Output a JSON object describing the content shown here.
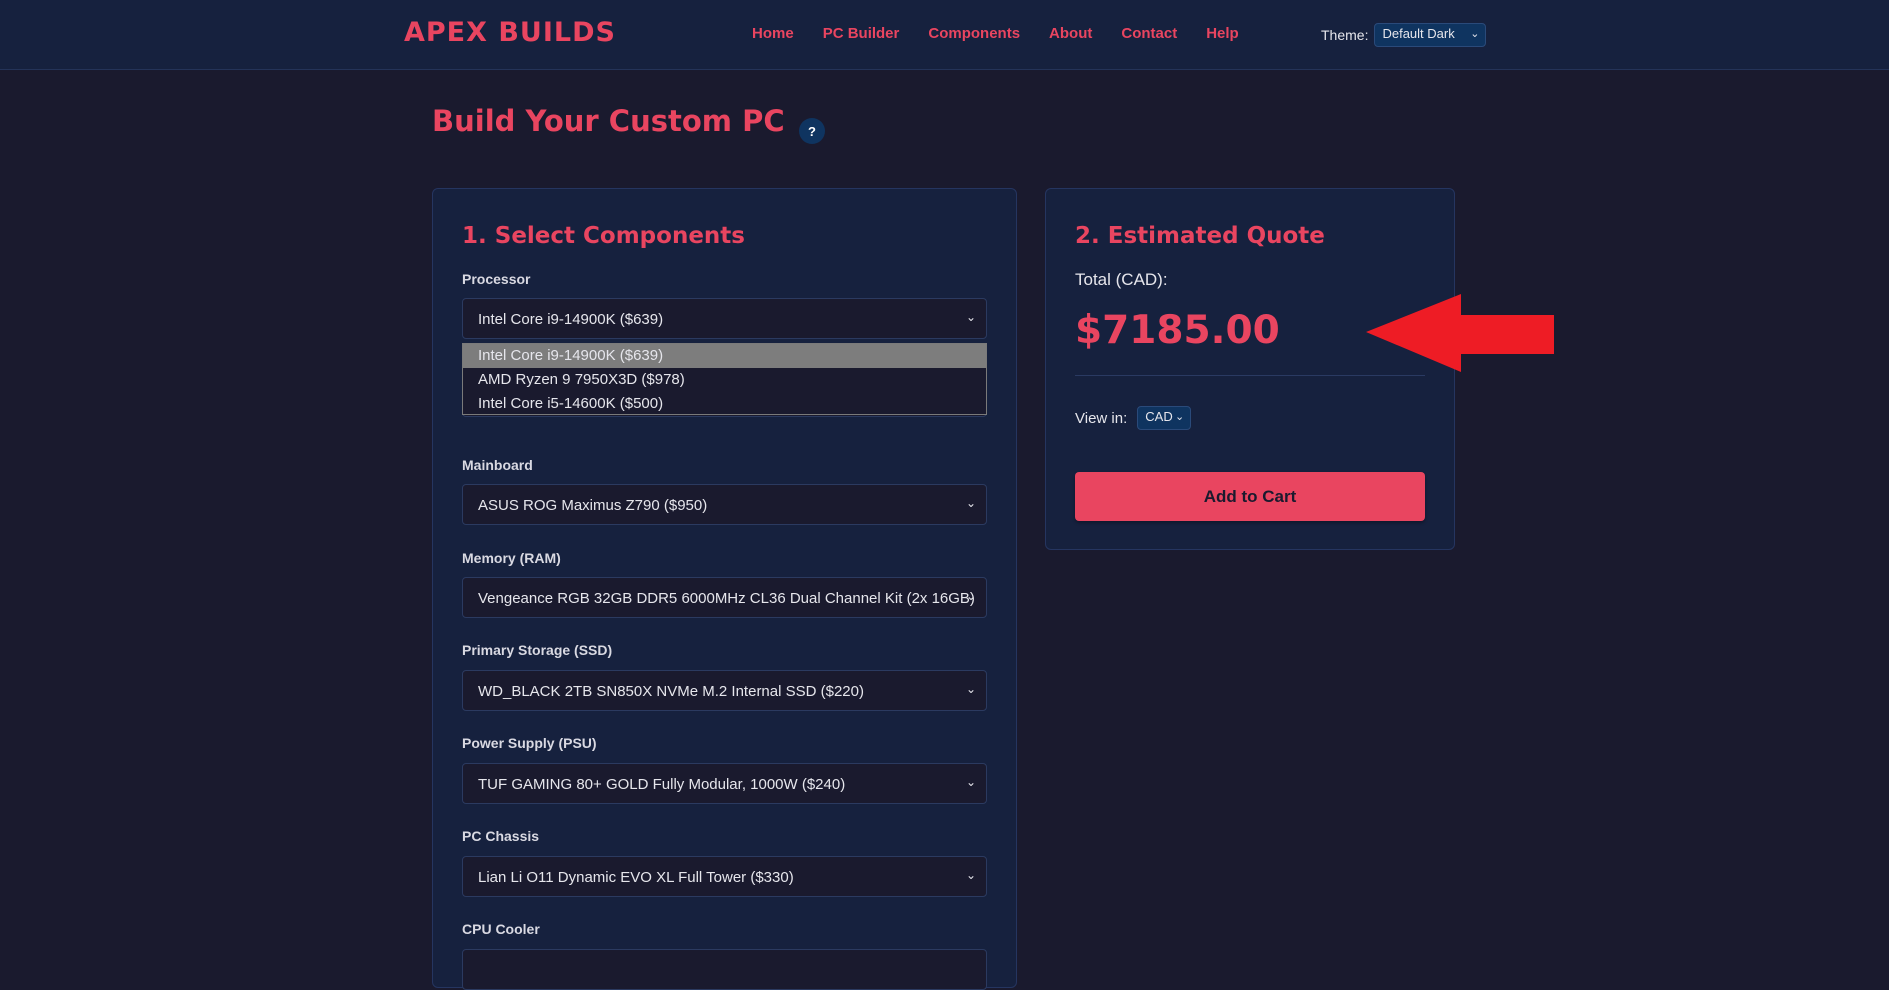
{
  "header": {
    "logo": "APEX BUILDS",
    "nav": [
      "Home",
      "PC Builder",
      "Components",
      "About",
      "Contact",
      "Help"
    ],
    "theme_label": "Theme:",
    "theme_value": "Default Dark"
  },
  "page": {
    "title": "Build Your Custom PC",
    "help_glyph": "?"
  },
  "components": {
    "heading": "1. Select Components",
    "fields": [
      {
        "label": "Processor",
        "value": "Intel Core i9-14900K ($639)"
      },
      {
        "label": "Mainboard",
        "value": "ASUS ROG Maximus Z790 ($950)"
      },
      {
        "label": "Memory (RAM)",
        "value": "Vengeance RGB 32GB DDR5 6000MHz CL36 Dual Channel Kit (2x 16GB)"
      },
      {
        "label": "Primary Storage (SSD)",
        "value": "WD_BLACK 2TB SN850X NVMe M.2 Internal SSD ($220)"
      },
      {
        "label": "Power Supply (PSU)",
        "value": "TUF GAMING 80+ GOLD Fully Modular, 1000W ($240)"
      },
      {
        "label": "PC Chassis",
        "value": "Lian Li O11 Dynamic EVO XL Full Tower ($330)"
      },
      {
        "label": "CPU Cooler",
        "value": ""
      }
    ],
    "processor_dropdown": {
      "options": [
        "Intel Core i9-14900K ($639)",
        "AMD Ryzen 9 7950X3D ($978)",
        "Intel Core i5-14600K ($500)"
      ],
      "selected_index": 0
    }
  },
  "quote": {
    "heading": "2. Estimated Quote",
    "total_label": "Total (CAD):",
    "total_value": "$7185.00",
    "view_in_label": "View in:",
    "currency": "CAD",
    "cart_button": "Add to Cart"
  },
  "colors": {
    "accent": "#e94560",
    "background": "#1a1a2e",
    "panel": "#16213e",
    "arrow": "#ee1c25"
  },
  "icons": [
    "chevron-down-icon",
    "help-icon",
    "arrow-annotation-icon"
  ]
}
